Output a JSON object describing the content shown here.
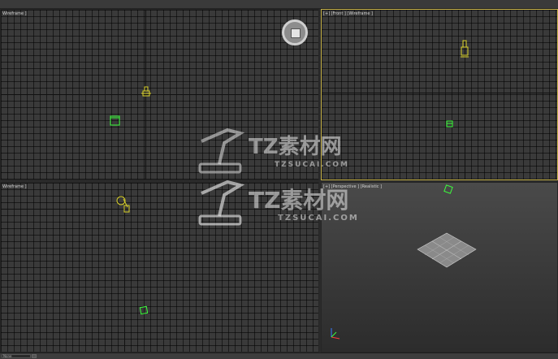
{
  "viewports": {
    "top": {
      "label": "Wireframe ]"
    },
    "front": {
      "label": "[+] [Front ] [Wireframe ]"
    },
    "left": {
      "label": "Wireframe ]"
    },
    "perspective": {
      "label": "[+] [Perspective ] [Realistic ]"
    }
  },
  "statusbar": {
    "field_value": "None"
  },
  "watermark": {
    "brand": "TZ素材网",
    "url": "TZSUCAI.COM"
  },
  "icons": {
    "navcube": "view-cube-icon",
    "axis": "axis-tripod-icon"
  },
  "colors": {
    "active_border": "#c8b44a",
    "object_green": "#3cff3c",
    "object_yellow": "#d9d12a"
  }
}
